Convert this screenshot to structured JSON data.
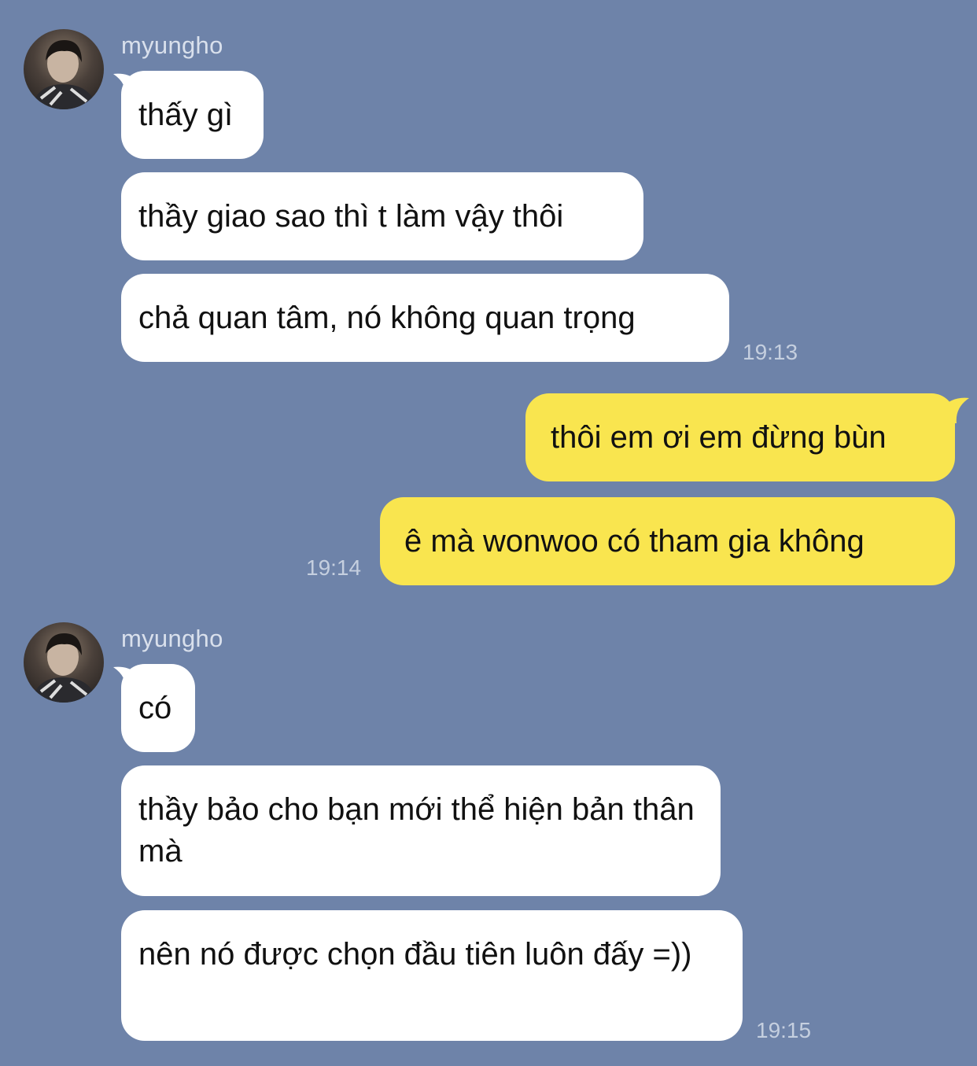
{
  "colors": {
    "background": "#6e83a9",
    "incoming_bubble": "#ffffff",
    "outgoing_bubble": "#f9e54f",
    "timestamp": "#c5cfdf"
  },
  "group1": {
    "sender": "myungho",
    "avatar_icon": "profile-photo",
    "messages": [
      "thấy gì",
      "thầy giao sao thì t làm vậy thôi",
      "chả quan tâm, nó không quan trọng"
    ],
    "time": "19:13"
  },
  "group2": {
    "messages": [
      "thôi em ơi em đừng bùn",
      "ê mà wonwoo có tham gia không"
    ],
    "time": "19:14"
  },
  "group3": {
    "sender": "myungho",
    "avatar_icon": "profile-photo",
    "messages": [
      "có",
      "thầy bảo cho bạn mới thể hiện bản thân mà",
      "nên nó được chọn đầu tiên luôn đấy =))"
    ],
    "time": "19:15"
  }
}
